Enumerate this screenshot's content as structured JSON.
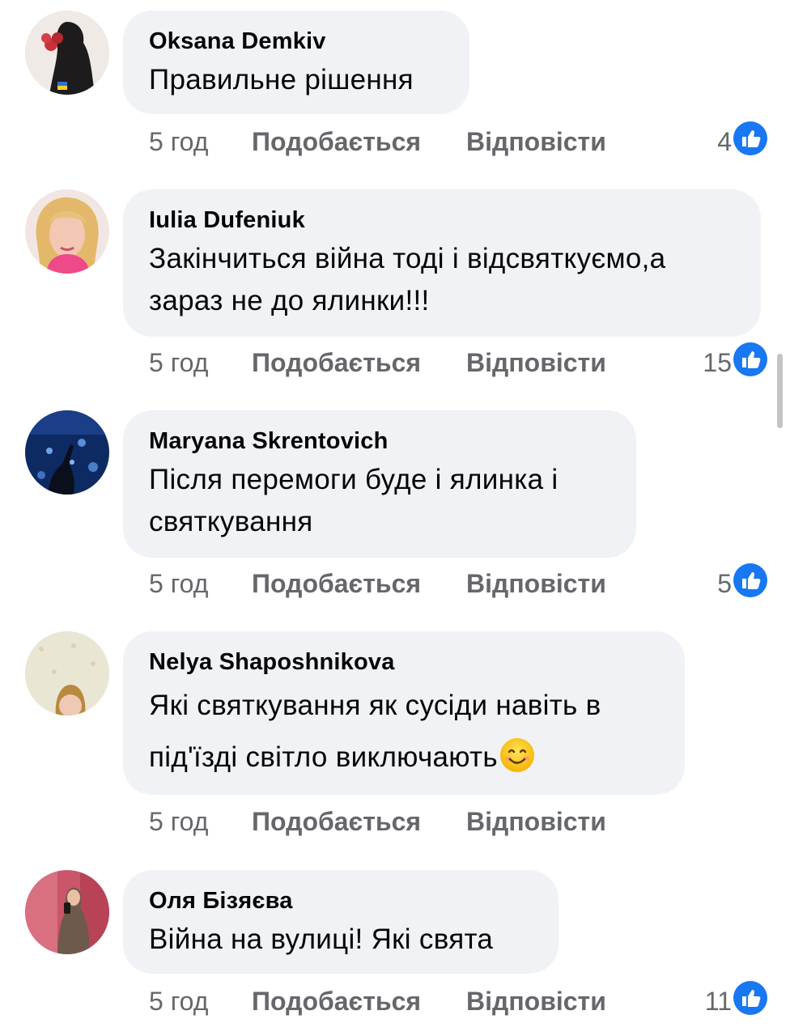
{
  "comments": [
    {
      "author": "Oksana Demkiv",
      "text_lines": [
        "Правильне рішення"
      ],
      "time": "5 год",
      "like_label": "Подобається",
      "reply_label": "Відповісти",
      "reactions": "4",
      "reaction_icon": "like-icon"
    },
    {
      "author": "Iulia Dufeniuk",
      "text_lines": [
        "Закінчиться війна тоді і відсвяткуємо,а",
        "зараз не до ялинки!!!"
      ],
      "time": "5 год",
      "like_label": "Подобається",
      "reply_label": "Відповісти",
      "reactions": "15",
      "reaction_icon": "like-icon"
    },
    {
      "author": "Maryana Skrentovich",
      "text_lines": [
        "Після перемоги буде і ялинка і",
        "святкування"
      ],
      "time": "5 год",
      "like_label": "Подобається",
      "reply_label": "Відповісти",
      "reactions": "5",
      "reaction_icon": "like-icon"
    },
    {
      "author": "Nelya Shaposhnikova",
      "text_lines": [
        "Які святкування як сусіди навіть в",
        "під'їзді світло виключають"
      ],
      "text_emoji": "smiling-face-emoji",
      "time": "5 год",
      "like_label": "Подобається",
      "reply_label": "Відповісти",
      "reactions": "",
      "reaction_icon": ""
    },
    {
      "author": "Оля Бізяєва",
      "text_lines": [
        "Війна на вулиці! Які свята"
      ],
      "time": "5 год",
      "like_label": "Подобається",
      "reply_label": "Відповісти",
      "reactions": "11",
      "reaction_icon": "like-icon"
    }
  ],
  "colors": {
    "bubble": "#f0f2f5",
    "meta_text": "#65676b",
    "like_blue": "#1877f2"
  }
}
